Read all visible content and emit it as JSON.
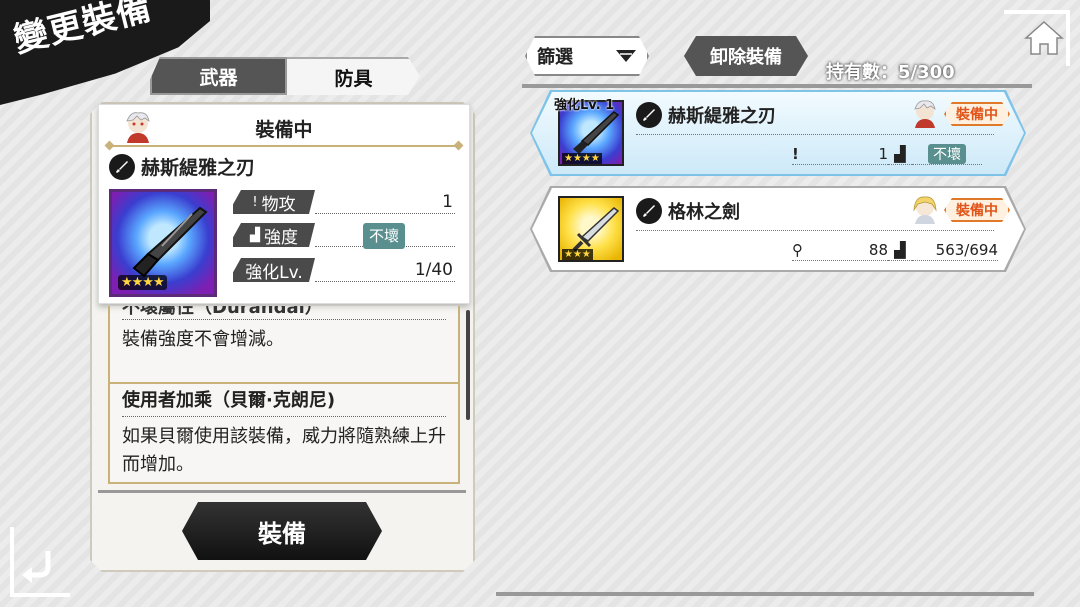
{
  "header": {
    "title": "變更裝備"
  },
  "tabs": [
    {
      "label": "武器",
      "active": false
    },
    {
      "label": "防具",
      "active": true
    }
  ],
  "equipped_panel": {
    "heading": "裝備中",
    "item_name": "赫斯緹雅之刃",
    "stars": "★★★★",
    "stats": [
      {
        "label": "物攻",
        "value": "1"
      },
      {
        "label": "強度",
        "value": "不壞"
      },
      {
        "label": "強化Lv.",
        "value": "1/40"
      }
    ],
    "desc_partial_heading": "不壞屬性（Durandal）",
    "desc1": "裝備強度不會增減。",
    "desc2_heading": "使用者加乘（貝爾·克朗尼)",
    "desc2": "如果貝爾使用該裝備，威力將隨熟練上升而增加。",
    "equip_button": "裝備"
  },
  "filter": {
    "label": "篩選"
  },
  "unequip_button": "卸除裝備",
  "owned_count": "持有數：5/300",
  "equipment_list": [
    {
      "enhance_label": "強化Lv. 1",
      "name": "赫斯緹雅之刃",
      "stars": "★★★★",
      "stat_value": "1",
      "durability": "不壞",
      "tag": "裝備中",
      "selected": true
    },
    {
      "enhance_label": "",
      "name": "格林之劍",
      "stars": "★★★",
      "stat_value": "88",
      "durability": "563/694",
      "tag": "裝備中",
      "selected": false
    }
  ],
  "colors": {
    "accent_gold": "#c8b27a",
    "tag_orange": "#e07a2a",
    "selected_blue": "#cde9f8",
    "dark": "#1a1a1a"
  }
}
